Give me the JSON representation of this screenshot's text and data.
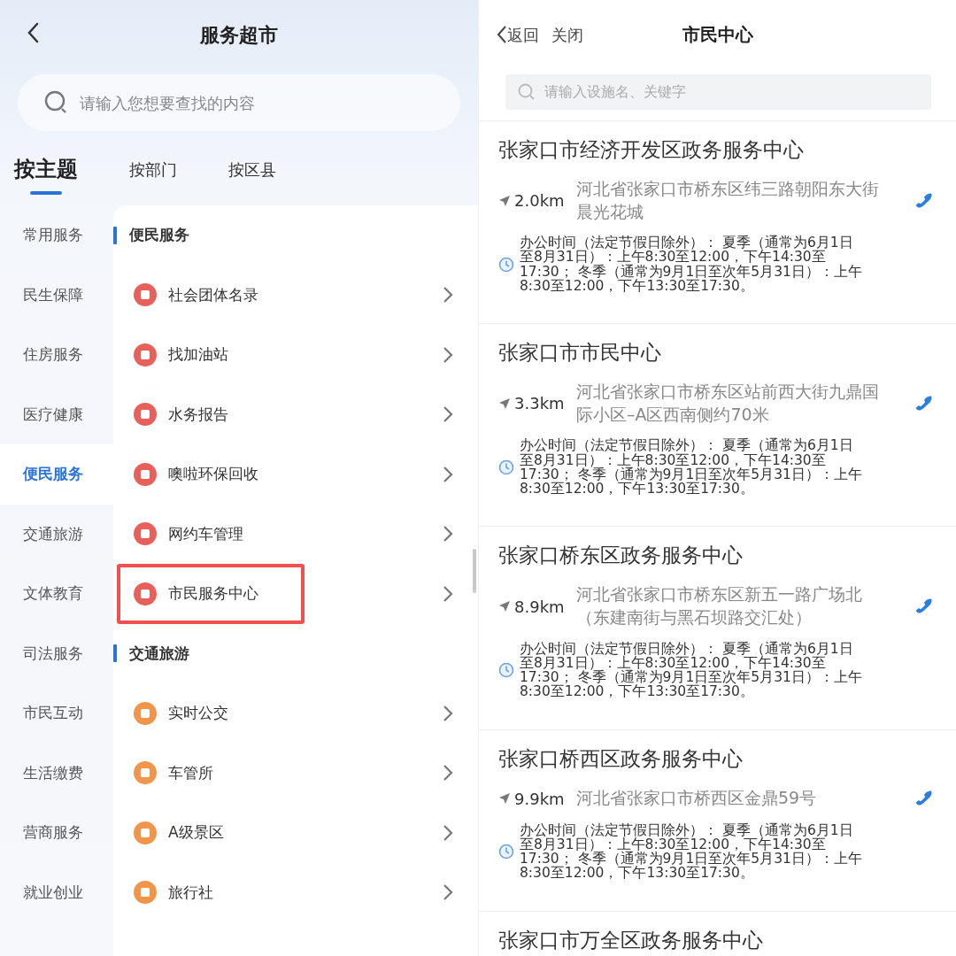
{
  "left": {
    "title": "服务超市",
    "search": {
      "placeholder": "请输入您想要查找的内容"
    },
    "tabs": [
      {
        "label": "按主题",
        "selected": true
      },
      {
        "label": "按部门",
        "selected": false
      },
      {
        "label": "按区县",
        "selected": false
      }
    ],
    "sidebar": {
      "items": [
        {
          "label": "常用服务",
          "selected": false
        },
        {
          "label": "民生保障",
          "selected": false
        },
        {
          "label": "住房服务",
          "selected": false
        },
        {
          "label": "医疗健康",
          "selected": false
        },
        {
          "label": "便民服务",
          "selected": true
        },
        {
          "label": "交通旅游",
          "selected": false
        },
        {
          "label": "文体教育",
          "selected": false
        },
        {
          "label": "司法服务",
          "selected": false
        },
        {
          "label": "市民互动",
          "selected": false
        },
        {
          "label": "生活缴费",
          "selected": false
        },
        {
          "label": "营商服务",
          "selected": false
        },
        {
          "label": "就业创业",
          "selected": false
        }
      ]
    },
    "sections": [
      {
        "title": "便民服务",
        "items": [
          {
            "label": "社会团体名录",
            "color": "#e8605a",
            "highlighted": false
          },
          {
            "label": "找加油站",
            "color": "#e8605a",
            "highlighted": false
          },
          {
            "label": "水务报告",
            "color": "#e8605a",
            "highlighted": false
          },
          {
            "label": "噢啦环保回收",
            "color": "#e8605a",
            "highlighted": false
          },
          {
            "label": "网约车管理",
            "color": "#e8605a",
            "highlighted": false
          },
          {
            "label": "市民服务中心",
            "color": "#e8605a",
            "highlighted": true
          }
        ]
      },
      {
        "title": "交通旅游",
        "items": [
          {
            "label": "实时公交",
            "color": "#f0954a",
            "highlighted": false
          },
          {
            "label": "车管所",
            "color": "#f0954a",
            "highlighted": false
          },
          {
            "label": "A级景区",
            "color": "#f0954a",
            "highlighted": false
          },
          {
            "label": "旅行社",
            "color": "#f0954a",
            "highlighted": false
          }
        ]
      }
    ]
  },
  "right": {
    "back": "返回",
    "close": "关闭",
    "title": "市民中心",
    "search": {
      "placeholder": "请输入设施名、关键字"
    },
    "places": [
      {
        "name": "张家口市经济开发区政务服务中心",
        "distance": "2.0km",
        "address": "河北省张家口市桥东区纬三路朝阳东大街晨光花城",
        "hours": "办公时间（法定节假日除外）： 夏季（通常为6月1日至8月31日）：上午8:30至12:00，下午14:30至17:30； 冬季（通常为9月1日至次年5月31日）：上午8:30至12:00，下午13:30至17:30。"
      },
      {
        "name": "张家口市市民中心",
        "distance": "3.3km",
        "address": "河北省张家口市桥东区站前西大街九鼎国际小区–A区西南侧约70米",
        "hours": "办公时间（法定节假日除外）： 夏季（通常为6月1日至8月31日）：上午8:30至12:00，下午14:30至17:30； 冬季（通常为9月1日至次年5月31日）：上午8:30至12:00，下午13:30至17:30。"
      },
      {
        "name": "张家口桥东区政务服务中心",
        "distance": "8.9km",
        "address": "河北省张家口市桥东区新五一路广场北（东建南街与黑石坝路交汇处）",
        "hours": "办公时间（法定节假日除外）： 夏季（通常为6月1日至8月31日）：上午8:30至12:00，下午14:30至17:30； 冬季（通常为9月1日至次年5月31日）：上午8:30至12:00，下午13:30至17:30。"
      },
      {
        "name": "张家口桥西区政务服务中心",
        "distance": "9.9km",
        "address": "河北省张家口市桥西区金鼎59号",
        "hours": "办公时间（法定节假日除外）： 夏季（通常为6月1日至8月31日）：上午8:30至12:00，下午14:30至17:30； 冬季（通常为9月1日至次年5月31日）：上午8:30至12:00，下午13:30至17:30。"
      },
      {
        "name": "张家口市万全区政务服务中心"
      }
    ]
  }
}
